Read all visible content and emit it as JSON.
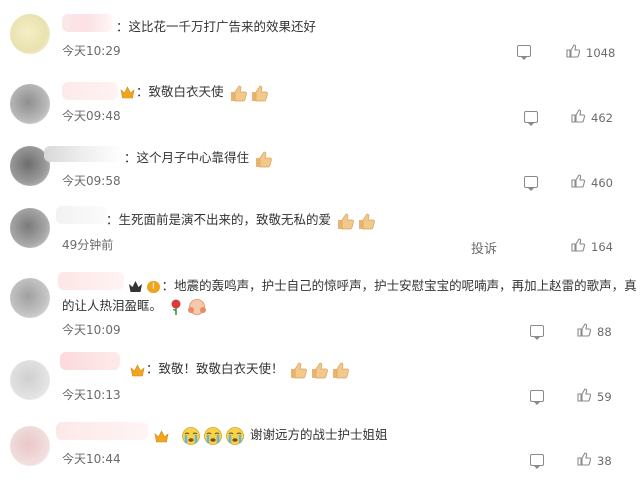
{
  "comments": [
    {
      "text": "：这比花一千万打广告来的效果还好",
      "time": "今天10:29",
      "likes": "1048"
    },
    {
      "text": "：致敬白衣天使",
      "time": "今天09:48",
      "likes": "462"
    },
    {
      "text": "：这个月子中心靠得住",
      "time": "今天09:58",
      "likes": "460"
    },
    {
      "text": "：生死面前是演不出来的，致敬无私的爱",
      "time": "49分钟前",
      "likes": "164",
      "report_label": "投诉"
    },
    {
      "text": "：地震的轰鸣声，护士自己的惊呼声，护士安慰宝宝的呢喃声，再加上赵雷的歌声，真的让人热泪盈眶。",
      "time": "今天10:09",
      "likes": "88",
      "badge_level": "I"
    },
    {
      "text": "：致敬！致敬白衣天使！",
      "time": "今天10:13",
      "likes": "59"
    },
    {
      "text": "谢谢远方的战士护士姐姐",
      "time": "今天10:44",
      "likes": "38"
    }
  ],
  "icons": {
    "comment": "comment-icon",
    "like": "thumbs-up-icon",
    "crown": "crown-icon",
    "thumbs_emoji": "thumbs-up-emoji",
    "rose_emoji": "rose-emoji",
    "hug_emoji": "hug-emoji",
    "crying_emoji": "crying-face-emoji"
  },
  "colors": {
    "text": "#333333",
    "meta": "#6b6b6b",
    "emoji_yellow": "#f2c98b",
    "crown_gold": "#f0a51e"
  }
}
